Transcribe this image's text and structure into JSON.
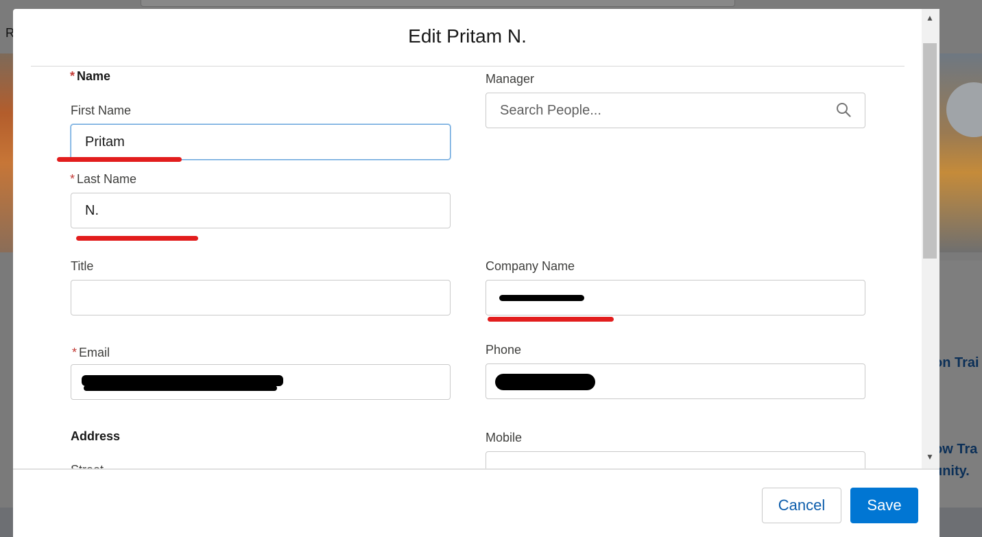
{
  "background": {
    "nav_letter": "R",
    "text_1": "on Trai",
    "text_2": "ow Tra",
    "text_3": "unity."
  },
  "modal": {
    "title": "Edit Pritam N.",
    "name_section": {
      "required_mark": "*",
      "label": "Name"
    },
    "first_name": {
      "label": "First Name",
      "value": "Pritam"
    },
    "last_name": {
      "required_mark": "*",
      "label": "Last Name",
      "value": "N."
    },
    "title_field": {
      "label": "Title",
      "value": ""
    },
    "email": {
      "required_mark": "*",
      "label": "Email",
      "value": ""
    },
    "address_section": {
      "label": "Address"
    },
    "street": {
      "label": "Street"
    },
    "manager": {
      "label": "Manager",
      "placeholder": "Search People..."
    },
    "company_name": {
      "label": "Company Name",
      "value": ""
    },
    "phone": {
      "label": "Phone",
      "value": ""
    },
    "mobile": {
      "label": "Mobile",
      "value": ""
    }
  },
  "footer": {
    "cancel_label": "Cancel",
    "save_label": "Save"
  },
  "colors": {
    "required": "#c23934",
    "primary": "#0176d3",
    "annotation_red": "#e21d1d"
  },
  "icons": [
    "search-icon",
    "scroll-up-arrow-icon",
    "scroll-down-arrow-icon"
  ]
}
